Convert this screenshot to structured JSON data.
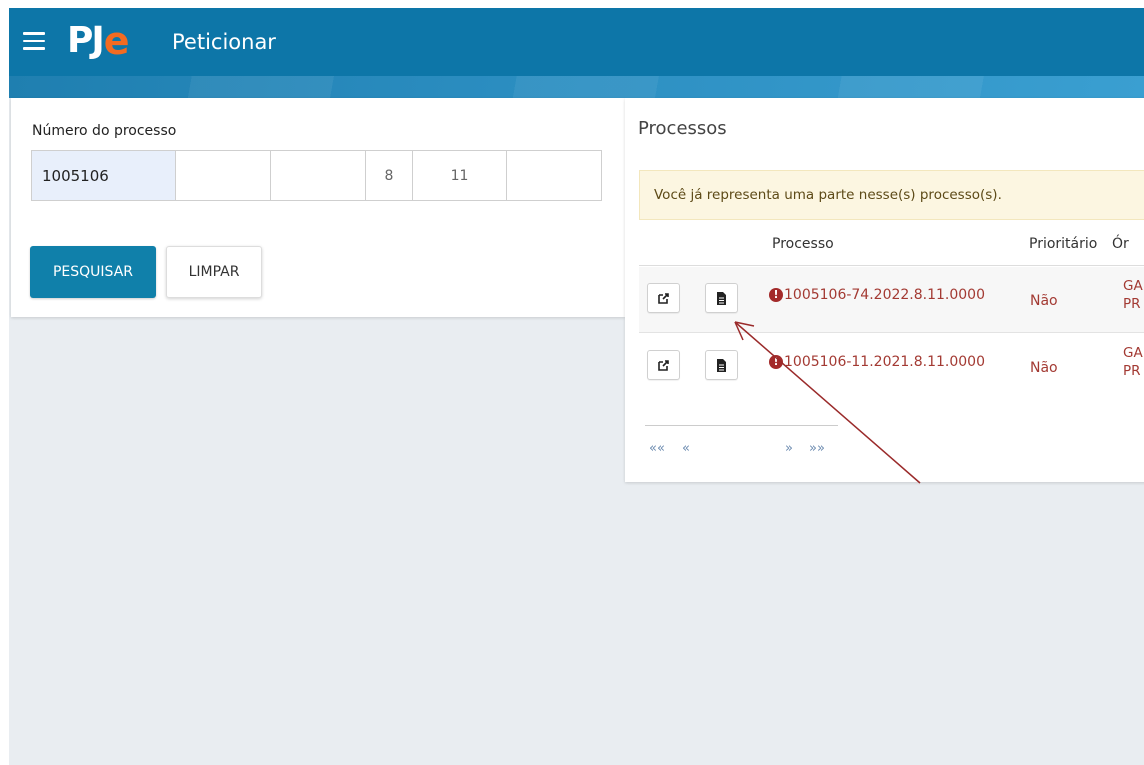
{
  "header": {
    "logo_text_pj": "PJ",
    "logo_text_e": "e",
    "title": "Peticionar",
    "menu_icon": "hamburger-menu-icon",
    "colors": {
      "bar": "#0d76a8",
      "logo_accent": "#f26b21"
    }
  },
  "search": {
    "label": "Número do processo",
    "fields": [
      "1005106",
      "",
      "",
      "8",
      "11",
      ""
    ],
    "search_button": "PESQUISAR",
    "clear_button": "LIMPAR"
  },
  "results": {
    "title": "Processos",
    "alert": "Você já representa uma parte nesse(s) processo(s).",
    "columns": {
      "processo": "Processo",
      "prioritario": "Prioritário",
      "orgao": "Ór"
    },
    "rows": [
      {
        "numero": "1005106-74.2022.8.11.0000",
        "prioritario": "Não",
        "orgao_l1": "GA",
        "orgao_l2": "PR"
      },
      {
        "numero": "1005106-11.2021.8.11.0000",
        "prioritario": "Não",
        "orgao_l1": "GA",
        "orgao_l2": "PR"
      }
    ],
    "pagination": {
      "first": "««",
      "prev": "«",
      "next": "»",
      "last": "»»"
    }
  }
}
